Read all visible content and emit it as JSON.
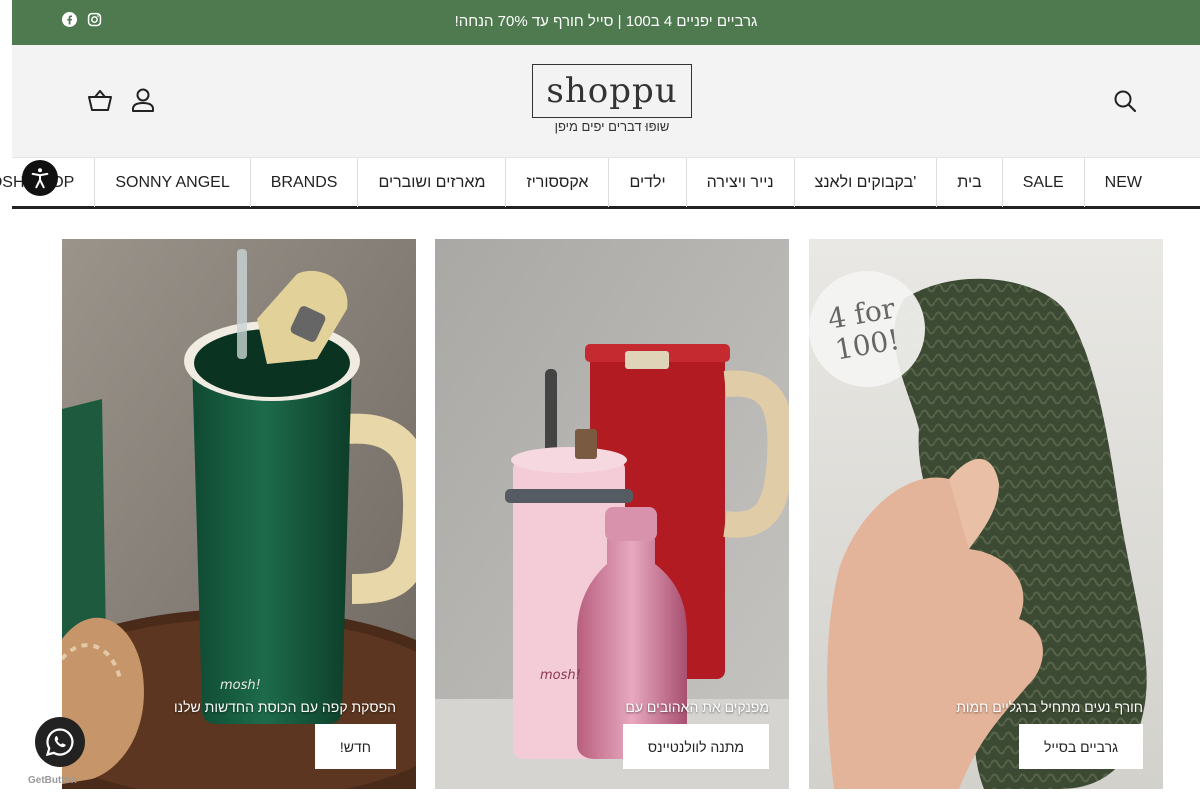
{
  "announcement": {
    "text": "גרביים יפניים 4 ב100 | סייל חורף עד 70% הנחה!"
  },
  "social": {
    "icons": [
      "facebook-icon",
      "instagram-icon"
    ]
  },
  "brand": {
    "logo": "shoppu",
    "tagline": "שופּוּ דברים יפים מיפן"
  },
  "nav": {
    "items": [
      "NEW",
      "SALE",
      "בית",
      "בקבוקים ולאנצ'",
      "נייר ויצירה",
      "ילדים",
      "אקססוריז",
      "מארזים ושוברים",
      "BRANDS",
      "SONNY ANGEL",
      "MOSH SHOP"
    ]
  },
  "cards": [
    {
      "caption": "חורף נעים מתחיל ברגליים חמות",
      "button": "גרביים בסייל",
      "badge": "4 for 100!"
    },
    {
      "caption": "מפנקים את האהובים עם",
      "button": "מתנה לוולנטיינס",
      "bottle_mark": "mosh!"
    },
    {
      "caption": "הפסקת קפה עם הכוסת החדשות שלנו",
      "button": "חדש!",
      "bottle_mark": "mosh!"
    }
  ],
  "widget": {
    "label": "GetButton"
  },
  "colors": {
    "announce_bg": "#4f7a4f",
    "header_bg": "#f3f3f3"
  }
}
